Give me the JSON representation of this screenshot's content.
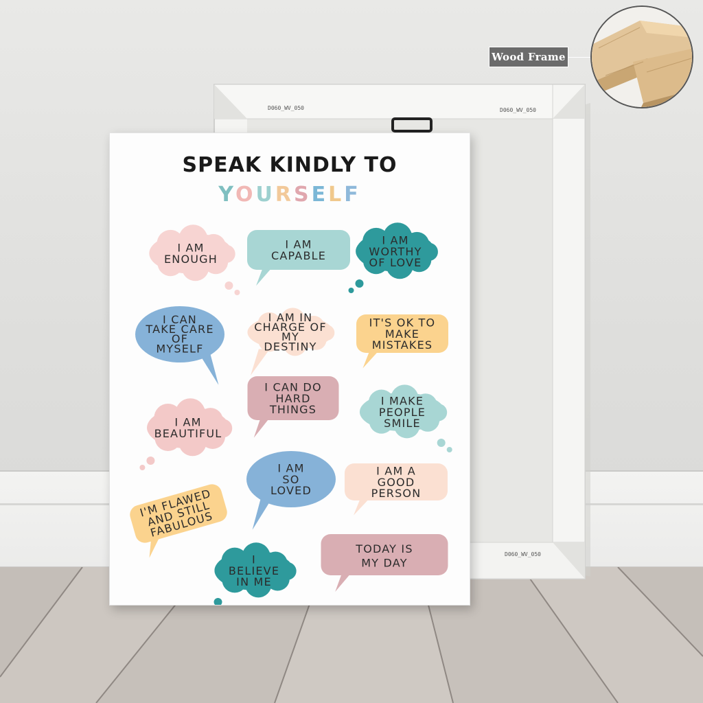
{
  "callout": {
    "label": "Wood Frame"
  },
  "poster": {
    "title_line1": "SPEAK KINDLY TO",
    "title_line2_letters": [
      {
        "ch": "Y",
        "color": "#7fbfc0"
      },
      {
        "ch": "O",
        "color": "#f1b8b5"
      },
      {
        "ch": "U",
        "color": "#9dd0cf"
      },
      {
        "ch": "R",
        "color": "#f2c99a"
      },
      {
        "ch": "S",
        "color": "#e0a7ae"
      },
      {
        "ch": "E",
        "color": "#7bb7d6"
      },
      {
        "ch": "L",
        "color": "#f0c88c"
      },
      {
        "ch": "F",
        "color": "#8fb9da"
      }
    ],
    "bubbles": [
      {
        "lines": [
          "I AM",
          "ENOUGH"
        ],
        "color": "#f7d4d2"
      },
      {
        "lines": [
          "I AM",
          "CAPABLE"
        ],
        "color": "#a8d6d4"
      },
      {
        "lines": [
          "I AM",
          "WORTHY",
          "OF LOVE"
        ],
        "color": "#2e9a9c"
      },
      {
        "lines": [
          "I CAN",
          "TAKE CARE",
          "OF",
          "MYSELF"
        ],
        "color": "#86b2d8"
      },
      {
        "lines": [
          "I AM IN",
          "CHARGE OF",
          "MY",
          "DESTINY"
        ],
        "color": "#fbe0d2"
      },
      {
        "lines": [
          "IT'S OK TO",
          "MAKE",
          "MISTAKES"
        ],
        "color": "#fbd38e"
      },
      {
        "lines": [
          "I CAN DO",
          "HARD",
          "THINGS"
        ],
        "color": "#d9aeb3"
      },
      {
        "lines": [
          "I MAKE",
          "PEOPLE",
          "SMILE"
        ],
        "color": "#a8d6d4"
      },
      {
        "lines": [
          "I AM",
          "BEAUTIFUL"
        ],
        "color": "#f3c9c8"
      },
      {
        "lines": [
          "I AM",
          "SO",
          "LOVED"
        ],
        "color": "#86b2d8"
      },
      {
        "lines": [
          "I AM A",
          "GOOD",
          "PERSON"
        ],
        "color": "#fbe0d2"
      },
      {
        "lines": [
          "I'M FLAWED",
          "AND STILL",
          "FABULOUS"
        ],
        "color": "#fbd38e"
      },
      {
        "lines": [
          "I",
          "BELIEVE",
          "IN ME"
        ],
        "color": "#2e9a9c"
      },
      {
        "lines": [
          "TODAY IS",
          "MY DAY"
        ],
        "color": "#d9aeb3"
      }
    ]
  }
}
